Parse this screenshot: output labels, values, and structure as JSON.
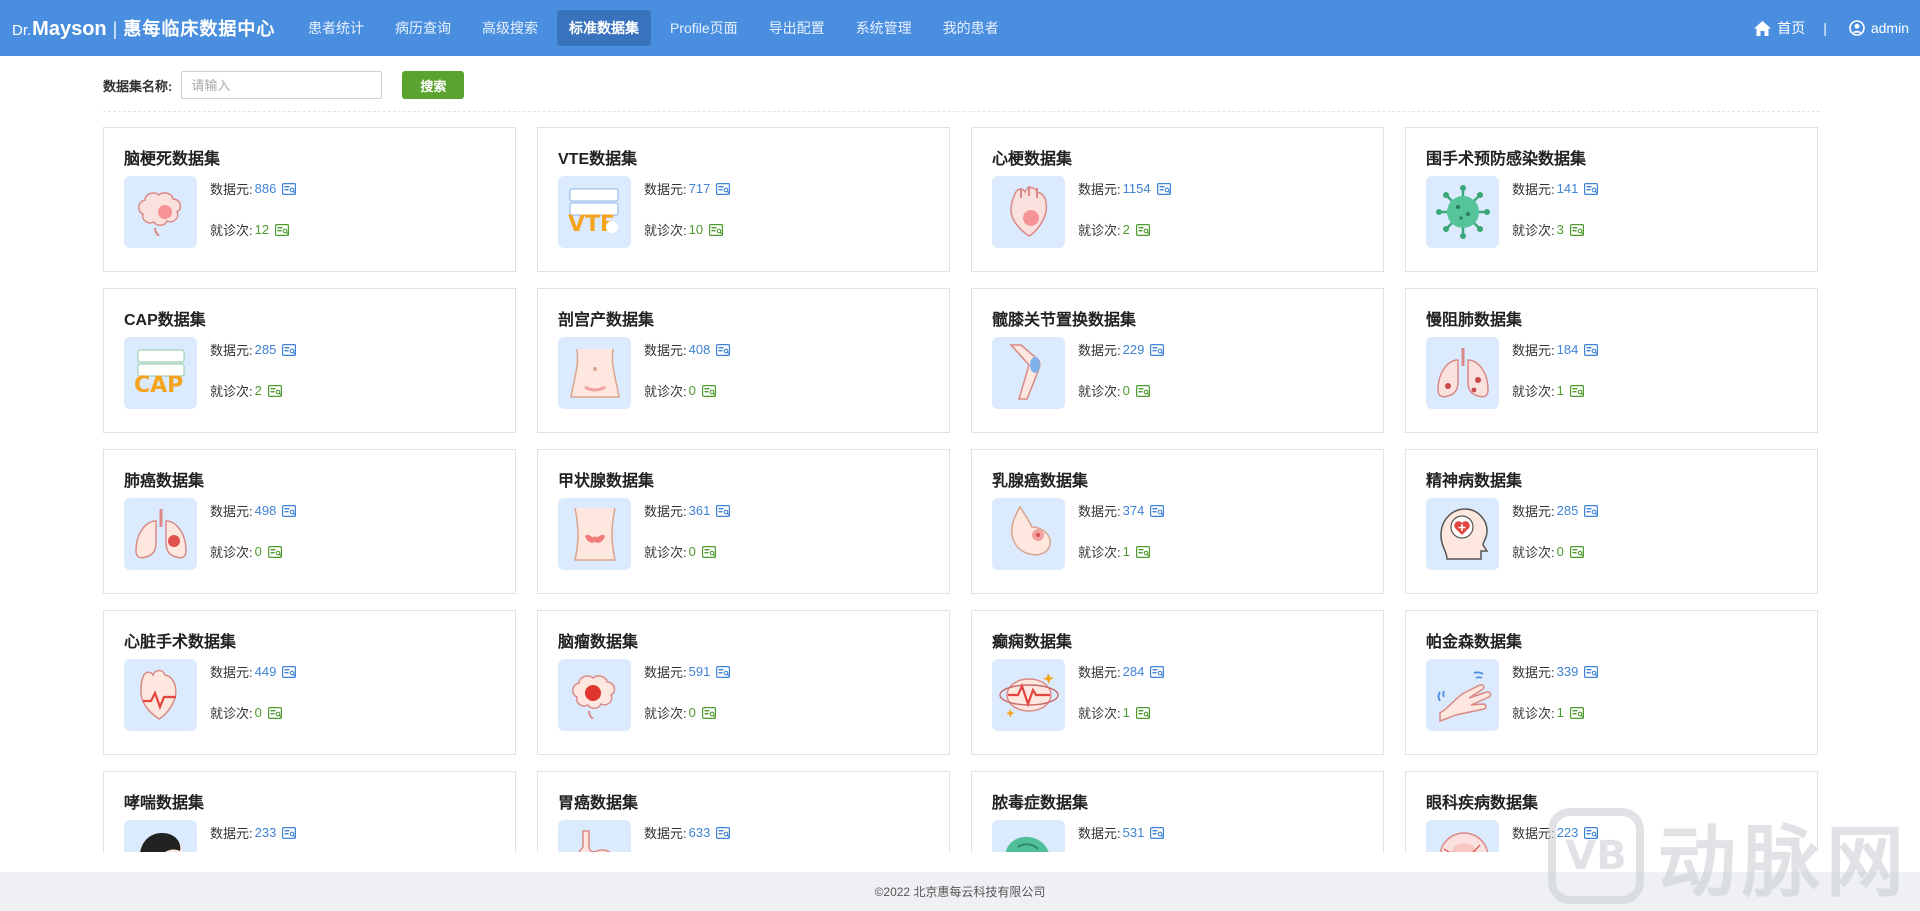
{
  "header": {
    "brand_dr": "Dr.",
    "brand_name": "Mayson",
    "brand_sep": "|",
    "brand_title": "惠每临床数据中心",
    "nav": [
      {
        "label": "患者统计",
        "active": false
      },
      {
        "label": "病历查询",
        "active": false
      },
      {
        "label": "高级搜索",
        "active": false
      },
      {
        "label": "标准数据集",
        "active": true
      },
      {
        "label": "Profile页面",
        "active": false
      },
      {
        "label": "导出配置",
        "active": false
      },
      {
        "label": "系统管理",
        "active": false
      },
      {
        "label": "我的患者",
        "active": false
      }
    ],
    "home_label": "首页",
    "divider": "|",
    "user_label": "admin"
  },
  "search": {
    "label": "数据集名称:",
    "placeholder": "请输入",
    "value": "",
    "button_label": "搜索"
  },
  "labels": {
    "elements": "数据元:",
    "visits": "就诊次:"
  },
  "datasets": [
    {
      "name": "脑梗死数据集",
      "elements": "886",
      "visits": "12",
      "icon": "brain-icon"
    },
    {
      "name": "VTE数据集",
      "elements": "717",
      "visits": "10",
      "icon": "vte-icon"
    },
    {
      "name": "心梗数据集",
      "elements": "1154",
      "visits": "2",
      "icon": "heart-icon"
    },
    {
      "name": "围手术预防感染数据集",
      "elements": "141",
      "visits": "3",
      "icon": "virus-icon"
    },
    {
      "name": "CAP数据集",
      "elements": "285",
      "visits": "2",
      "icon": "cap-icon"
    },
    {
      "name": "剖宫产数据集",
      "elements": "408",
      "visits": "0",
      "icon": "abdomen-icon"
    },
    {
      "name": "髋膝关节置换数据集",
      "elements": "229",
      "visits": "0",
      "icon": "knee-icon"
    },
    {
      "name": "慢阻肺数据集",
      "elements": "184",
      "visits": "1",
      "icon": "lungs-icon"
    },
    {
      "name": "肺癌数据集",
      "elements": "498",
      "visits": "0",
      "icon": "lungs-tumor-icon"
    },
    {
      "name": "甲状腺数据集",
      "elements": "361",
      "visits": "0",
      "icon": "thyroid-icon"
    },
    {
      "name": "乳腺癌数据集",
      "elements": "374",
      "visits": "1",
      "icon": "breast-icon"
    },
    {
      "name": "精神病数据集",
      "elements": "285",
      "visits": "0",
      "icon": "head-icon"
    },
    {
      "name": "心脏手术数据集",
      "elements": "449",
      "visits": "0",
      "icon": "heart-pulse-icon"
    },
    {
      "name": "脑瘤数据集",
      "elements": "591",
      "visits": "0",
      "icon": "brain-tumor-icon"
    },
    {
      "name": "癫痫数据集",
      "elements": "284",
      "visits": "1",
      "icon": "epilepsy-icon"
    },
    {
      "name": "帕金森数据集",
      "elements": "339",
      "visits": "1",
      "icon": "hand-icon"
    },
    {
      "name": "哮喘数据集",
      "elements": "233",
      "visits": "",
      "icon": "asthma-icon"
    },
    {
      "name": "胃癌数据集",
      "elements": "633",
      "visits": "",
      "icon": "stomach-icon"
    },
    {
      "name": "脓毒症数据集",
      "elements": "531",
      "visits": "",
      "icon": "sepsis-icon"
    },
    {
      "name": "眼科疾病数据集",
      "elements": "223",
      "visits": "",
      "icon": "eye-icon"
    }
  ],
  "footer": {
    "copyright": "©2022 北京惠每云科技有限公司"
  },
  "watermark": {
    "badge": "VB",
    "text": "动脉网"
  },
  "colors": {
    "nav_bg": "#4a8fdf",
    "nav_active": "#3a73bd",
    "search_button": "#5aa32e",
    "value_blue": "#3f82d6",
    "value_green": "#4f9a2e",
    "icon_bg": "#dbeafd"
  }
}
